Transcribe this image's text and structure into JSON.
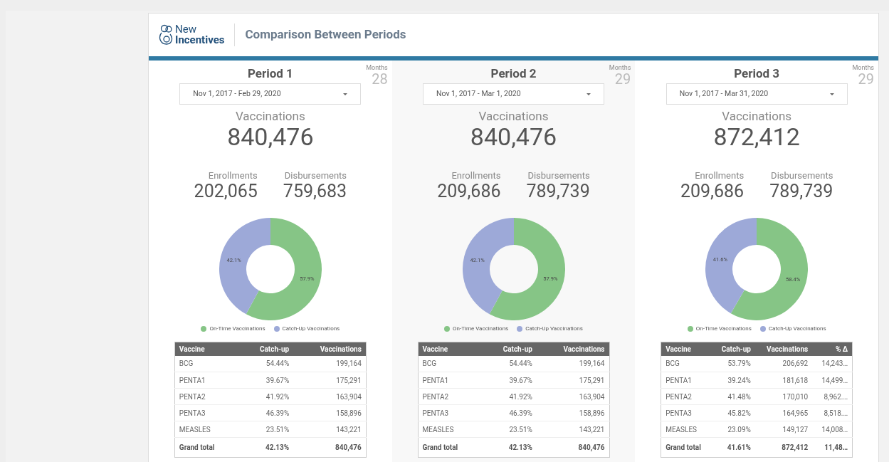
{
  "header": {
    "logo_line_1": "New",
    "logo_line_2": "Incentives",
    "title": "Comparison Between Periods"
  },
  "periods": [
    {
      "title": "Period 1",
      "months_label": "Months",
      "months": "28",
      "date_range": "Nov 1, 2017 - Feb 29, 2020",
      "vaccinations_label": "Vaccinations",
      "vaccinations": "840,476",
      "enrollments_label": "Enrollments",
      "enrollments": "202,065",
      "disbursements_label": "Disbursements",
      "disbursements": "759,683",
      "chart_data": {
        "type": "donut",
        "categories": [
          "On-Time Vaccinations",
          "Catch-Up Vaccinations"
        ],
        "values": [
          57.9,
          42.1
        ],
        "colors": [
          "#86c586",
          "#9da9d8"
        ],
        "value_labels": [
          "57.9%",
          "42.1%"
        ],
        "legend": "bottom"
      },
      "table": {
        "columns": [
          "Vaccine",
          "Catch-up",
          "Vaccinations"
        ],
        "rows": [
          [
            "BCG",
            "54.44%",
            "199,164"
          ],
          [
            "PENTA1",
            "39.67%",
            "175,291"
          ],
          [
            "PENTA2",
            "41.92%",
            "163,904"
          ],
          [
            "PENTA3",
            "46.39%",
            "158,896"
          ],
          [
            "MEASLES",
            "23.51%",
            "143,221"
          ]
        ],
        "total": [
          "Grand total",
          "42.13%",
          "840,476"
        ]
      }
    },
    {
      "title": "Period 2",
      "months_label": "Months",
      "months": "29",
      "date_range": "Nov 1, 2017 - Mar 1, 2020",
      "vaccinations_label": "Vaccinations",
      "vaccinations": "840,476",
      "enrollments_label": "Enrollments",
      "enrollments": "209,686",
      "disbursements_label": "Disbursements",
      "disbursements": "789,739",
      "chart_data": {
        "type": "donut",
        "categories": [
          "On-Time Vaccinations",
          "Catch-Up Vaccinations"
        ],
        "values": [
          57.9,
          42.1
        ],
        "colors": [
          "#86c586",
          "#9da9d8"
        ],
        "value_labels": [
          "57.9%",
          "42.1%"
        ],
        "legend": "bottom"
      },
      "table": {
        "columns": [
          "Vaccine",
          "Catch-up",
          "Vaccinations"
        ],
        "rows": [
          [
            "BCG",
            "54.44%",
            "199,164"
          ],
          [
            "PENTA1",
            "39.67%",
            "175,291"
          ],
          [
            "PENTA2",
            "41.92%",
            "163,904"
          ],
          [
            "PENTA3",
            "46.39%",
            "158,896"
          ],
          [
            "MEASLES",
            "23.51%",
            "143,221"
          ]
        ],
        "total": [
          "Grand total",
          "42.13%",
          "840,476"
        ]
      }
    },
    {
      "title": "Period 3",
      "months_label": "Months",
      "months": "29",
      "date_range": "Nov 1, 2017 - Mar 31, 2020",
      "vaccinations_label": "Vaccinations",
      "vaccinations": "872,412",
      "enrollments_label": "Enrollments",
      "enrollments": "209,686",
      "disbursements_label": "Disbursements",
      "disbursements": "789,739",
      "chart_data": {
        "type": "donut",
        "categories": [
          "On-Time Vaccinations",
          "Catch-Up Vaccinations"
        ],
        "values": [
          58.4,
          41.6
        ],
        "colors": [
          "#86c586",
          "#9da9d8"
        ],
        "value_labels": [
          "58.4%",
          "41.6%"
        ],
        "legend": "bottom"
      },
      "table": {
        "columns": [
          "Vaccine",
          "Catch-up",
          "Vaccinations",
          "% Δ"
        ],
        "rows": [
          [
            "BCG",
            "53.79%",
            "206,692",
            "14,243…"
          ],
          [
            "PENTA1",
            "39.24%",
            "181,618",
            "14,499…"
          ],
          [
            "PENTA2",
            "41.48%",
            "170,010",
            "8,962.…"
          ],
          [
            "PENTA3",
            "45.82%",
            "164,965",
            "8,518.…"
          ],
          [
            "MEASLES",
            "23.09%",
            "149,127",
            "14,008…"
          ]
        ],
        "total": [
          "Grand total",
          "41.61%",
          "872,412",
          "11,48…"
        ]
      }
    }
  ]
}
